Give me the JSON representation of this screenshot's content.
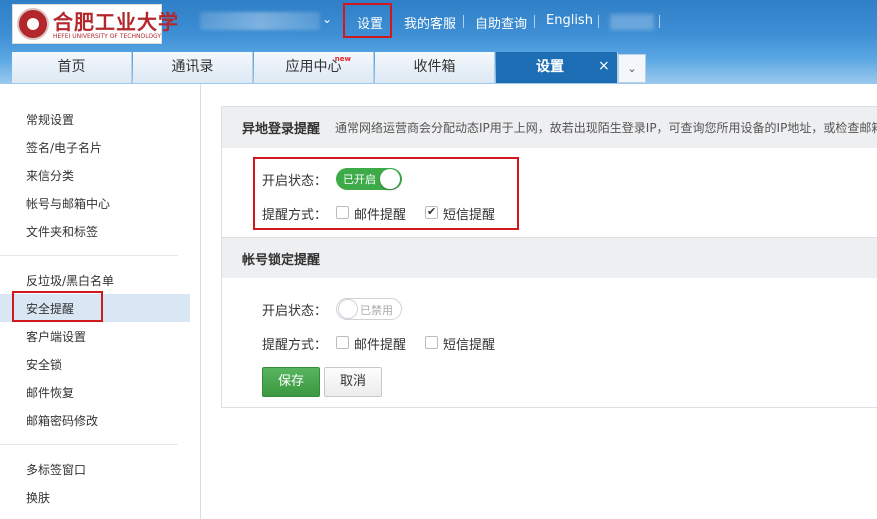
{
  "header": {
    "logo": {
      "name_cn": "合肥工业大学",
      "name_en": "HEFEI UNIVERSITY OF TECHNOLOGY"
    },
    "account_caret": "⌄",
    "nav": {
      "settings": "设置",
      "kefu": "我的客服",
      "self_query": "自助查询",
      "english": "English"
    }
  },
  "tabs": [
    {
      "label": "首页"
    },
    {
      "label": "通讯录"
    },
    {
      "label": "应用中心",
      "badge": "new"
    },
    {
      "label": "收件箱"
    },
    {
      "label": "设置"
    }
  ],
  "tab_close": "×",
  "tab_more": "⌄",
  "sidebar": {
    "group1": [
      "常规设置",
      "签名/电子名片",
      "来信分类",
      "帐号与邮箱中心",
      "文件夹和标签"
    ],
    "group2": [
      "反垃圾/黑白名单",
      "安全提醒",
      "客户端设置",
      "安全锁",
      "邮件恢复",
      "邮箱密码修改"
    ],
    "group3": [
      "多标签窗口",
      "换肤"
    ]
  },
  "remote_login": {
    "title": "异地登录提醒",
    "desc": "通常网络运营商会分配动态IP用于上网，故若出现陌生登录IP，可查询您所用设备的IP地址，或检查邮箱",
    "status_label": "开启状态：",
    "toggle_text": "已开启",
    "method_label": "提醒方式：",
    "email_option": "邮件提醒",
    "sms_option": "短信提醒"
  },
  "account_lock": {
    "title": "帐号锁定提醒",
    "status_label": "开启状态：",
    "toggle_text": "已禁用",
    "method_label": "提醒方式：",
    "email_option": "邮件提醒",
    "sms_option": "短信提醒"
  },
  "actions": {
    "save": "保存",
    "cancel": "取消"
  },
  "colors": {
    "header_blue": "#2f7fc7",
    "active_tab": "#1d6db4",
    "toggle_on": "#3eab49",
    "highlight_red": "#d0181d"
  }
}
